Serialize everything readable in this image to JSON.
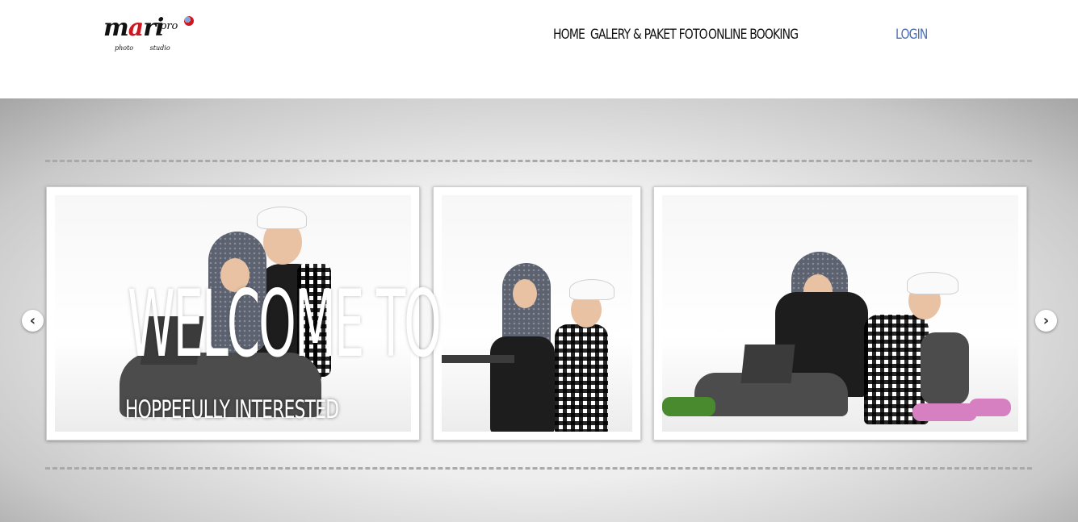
{
  "header": {
    "logo": {
      "main": "mari",
      "accent_letter": "a",
      "sub": "pro",
      "caption_left": "photo",
      "caption_right": "studio"
    },
    "nav": [
      {
        "label": "HOME"
      },
      {
        "label": "GALERY & PAKET FOTO"
      },
      {
        "label": "ONLINE BOOKING"
      }
    ],
    "login_label": "LOGIN",
    "login_color": "#4a6fb5"
  },
  "banner": {
    "headline": "WELCOME TO",
    "tagline": "HOPPEFULLY INTERESTED",
    "prev_icon": "chevron-left-icon",
    "next_icon": "chevron-right-icon",
    "prev_glyph": "‹",
    "next_glyph": "›"
  }
}
